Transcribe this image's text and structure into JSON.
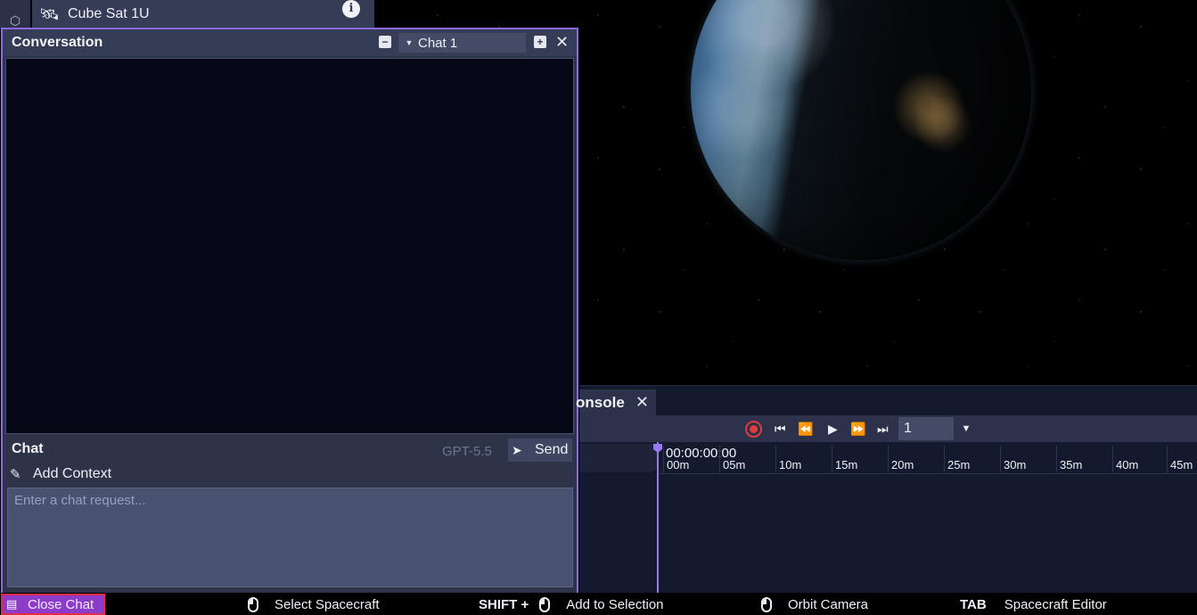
{
  "selected_object": {
    "name": "Cube Sat 1U",
    "icon": "satellite-icon",
    "info_icon": "info-icon"
  },
  "conversation": {
    "title": "Conversation",
    "chat_selector_value": "Chat 1",
    "chat_section_label": "Chat",
    "model": "GPT-5.5",
    "send_label": "Send",
    "add_context_label": "Add Context",
    "input_placeholder": "Enter a chat request..."
  },
  "console": {
    "tab_label": "onsole",
    "speed_value": "1",
    "current_time": "00:00:00:00",
    "ruler_ticks": [
      "00m",
      "05m",
      "10m",
      "15m",
      "20m",
      "25m",
      "30m",
      "35m",
      "40m",
      "45m"
    ]
  },
  "statusbar": {
    "close_chat": "Close Chat",
    "select_spacecraft": "Select Spacecraft",
    "shift_key": "SHIFT +",
    "add_to_selection": "Add to Selection",
    "orbit_camera": "Orbit Camera",
    "tab_key": "TAB",
    "spacecraft_editor": "Spacecraft Editor"
  },
  "colors": {
    "accent": "#8d6bf0",
    "record": "#e23b3b",
    "close_chat_bg": "#8d3cc9"
  }
}
